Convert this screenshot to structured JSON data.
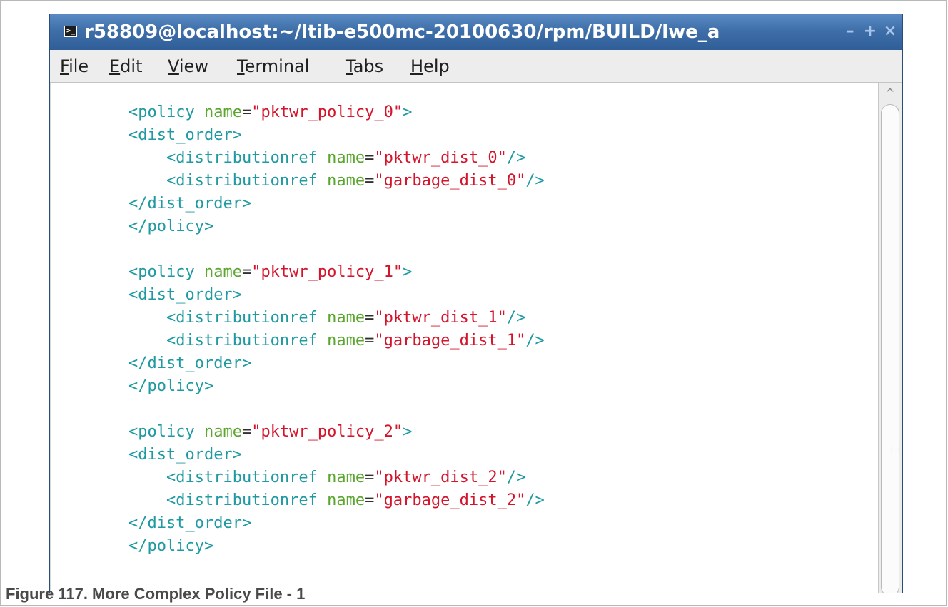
{
  "window": {
    "title": "r58809@localhost:~/ltib-e500mc-20100630/rpm/BUILD/lwe_a",
    "icon": "terminal-icon",
    "buttons": {
      "minimize": "–",
      "maximize": "+",
      "close": "×"
    }
  },
  "menu": [
    {
      "mnemonic": "F",
      "rest": "ile"
    },
    {
      "mnemonic": "E",
      "rest": "dit"
    },
    {
      "mnemonic": "V",
      "rest": "iew"
    },
    {
      "mnemonic": "T",
      "rest": "erminal"
    },
    {
      "mnemonic": "T",
      "rest": "abs"
    },
    {
      "mnemonic": "H",
      "rest": "elp"
    }
  ],
  "code_lines": [
    {
      "indent": "",
      "tag": "<policy",
      "attr": "name",
      "eq": "=",
      "str": "\"pktwr_policy_0\"",
      "close": ">"
    },
    {
      "indent": "",
      "tag": "<dist_order>",
      "attr": "",
      "eq": "",
      "str": "",
      "close": ""
    },
    {
      "indent": "    ",
      "tag": "<distributionref",
      "attr": "name",
      "eq": "=",
      "str": "\"pktwr_dist_0\"",
      "close": "/>"
    },
    {
      "indent": "    ",
      "tag": "<distributionref",
      "attr": "name",
      "eq": "=",
      "str": "\"garbage_dist_0\"",
      "close": "/>"
    },
    {
      "indent": "",
      "tag": "</dist_order>",
      "attr": "",
      "eq": "",
      "str": "",
      "close": ""
    },
    {
      "indent": "",
      "tag": "</policy>",
      "attr": "",
      "eq": "",
      "str": "",
      "close": ""
    },
    {
      "indent": "",
      "tag": "",
      "attr": "",
      "eq": "",
      "str": "",
      "close": ""
    },
    {
      "indent": "",
      "tag": "<policy",
      "attr": "name",
      "eq": "=",
      "str": "\"pktwr_policy_1\"",
      "close": ">"
    },
    {
      "indent": "",
      "tag": "<dist_order>",
      "attr": "",
      "eq": "",
      "str": "",
      "close": ""
    },
    {
      "indent": "    ",
      "tag": "<distributionref",
      "attr": "name",
      "eq": "=",
      "str": "\"pktwr_dist_1\"",
      "close": "/>"
    },
    {
      "indent": "    ",
      "tag": "<distributionref",
      "attr": "name",
      "eq": "=",
      "str": "\"garbage_dist_1\"",
      "close": "/>"
    },
    {
      "indent": "",
      "tag": "</dist_order>",
      "attr": "",
      "eq": "",
      "str": "",
      "close": ""
    },
    {
      "indent": "",
      "tag": "</policy>",
      "attr": "",
      "eq": "",
      "str": "",
      "close": ""
    },
    {
      "indent": "",
      "tag": "",
      "attr": "",
      "eq": "",
      "str": "",
      "close": ""
    },
    {
      "indent": "",
      "tag": "<policy",
      "attr": "name",
      "eq": "=",
      "str": "\"pktwr_policy_2\"",
      "close": ">"
    },
    {
      "indent": "",
      "tag": "<dist_order>",
      "attr": "",
      "eq": "",
      "str": "",
      "close": ""
    },
    {
      "indent": "    ",
      "tag": "<distributionref",
      "attr": "name",
      "eq": "=",
      "str": "\"pktwr_dist_2\"",
      "close": "/>"
    },
    {
      "indent": "    ",
      "tag": "<distributionref",
      "attr": "name",
      "eq": "=",
      "str": "\"garbage_dist_2\"",
      "close": "/>"
    },
    {
      "indent": "",
      "tag": "</dist_order>",
      "attr": "",
      "eq": "",
      "str": "",
      "close": ""
    },
    {
      "indent": "",
      "tag": "</policy>",
      "attr": "",
      "eq": "",
      "str": "",
      "close": ""
    }
  ],
  "scrollbar": {
    "up_arrow": "^"
  },
  "caption": "Figure 117.  More Complex Policy File - 1",
  "colors": {
    "titlebar": "#3f6fa8",
    "tag": "#1f9aa2",
    "attribute": "#5aa62e",
    "string": "#d3142a"
  }
}
